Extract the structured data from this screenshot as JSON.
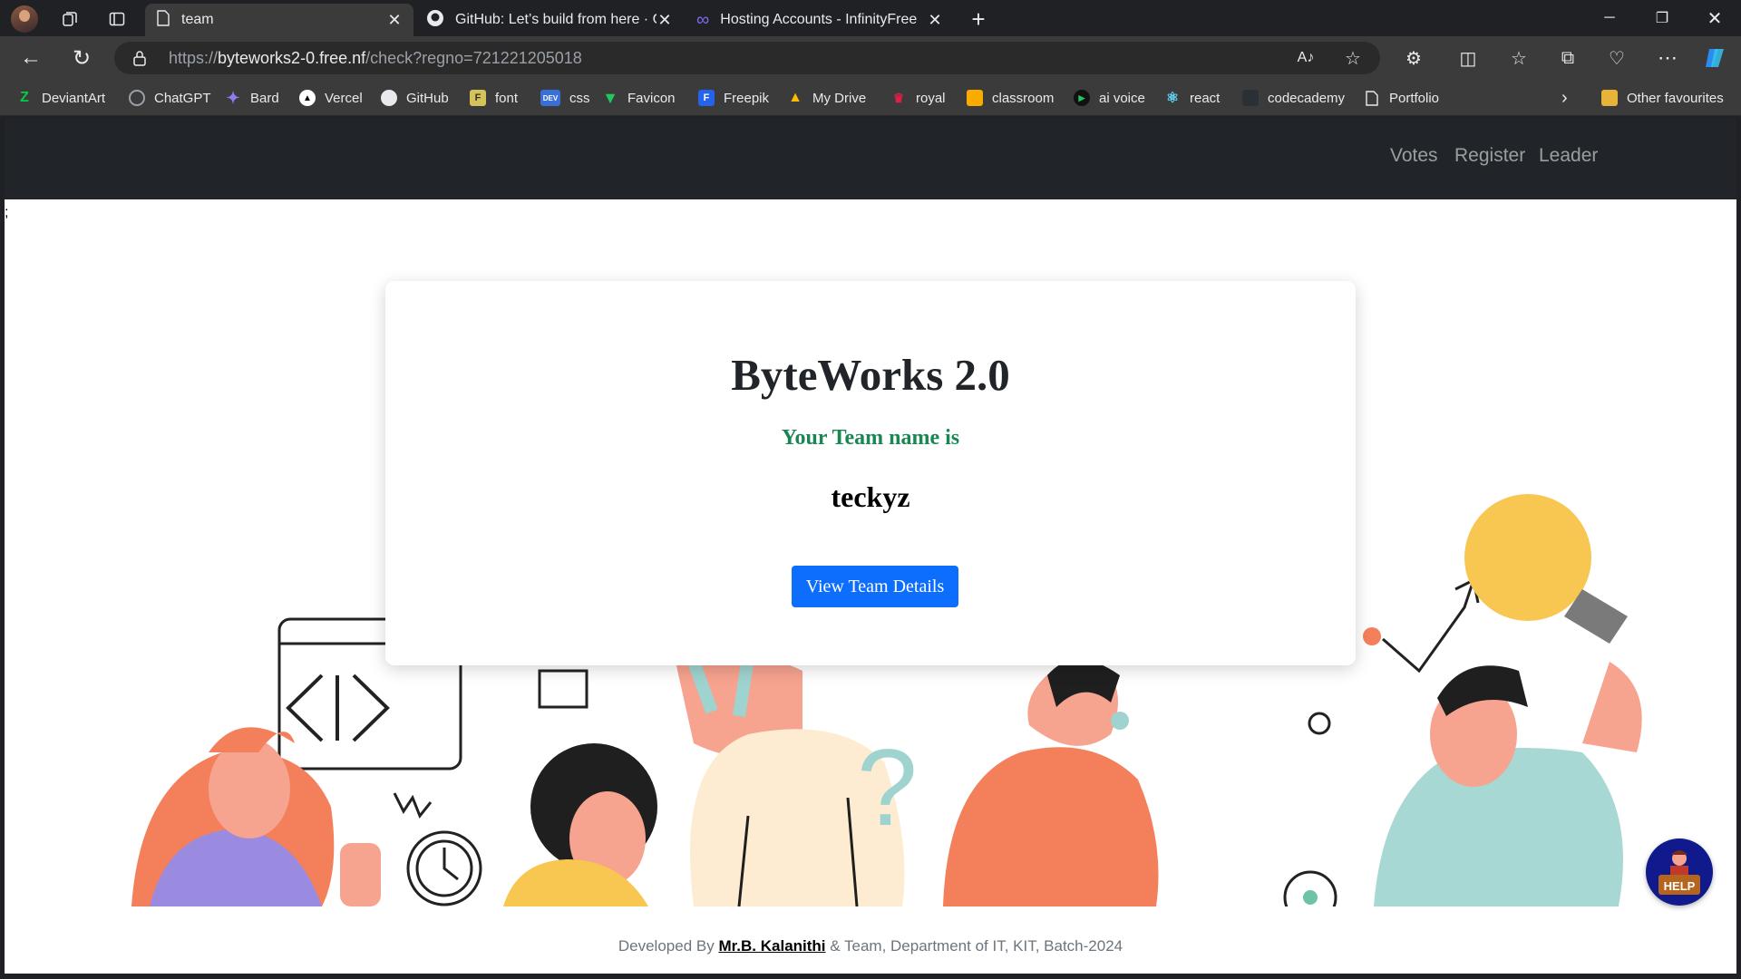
{
  "browser": {
    "tabs": [
      {
        "title": "team",
        "icon": "page-icon",
        "active": true
      },
      {
        "title": "GitHub: Let’s build from here · Gi",
        "icon": "github-icon",
        "active": false
      },
      {
        "title": "Hosting Accounts - InfinityFree",
        "icon": "infinity-icon",
        "active": false
      }
    ],
    "url_scheme": "https://",
    "url_host": "byteworks2-0.free.nf",
    "url_path": "/check?regno=721221205018",
    "bookmarks": [
      {
        "label": "DeviantArt",
        "icon": "deviantart-icon",
        "color": "#05cc47"
      },
      {
        "label": "ChatGPT",
        "icon": "chatgpt-icon",
        "color": "#74aa9c"
      },
      {
        "label": "Bard",
        "icon": "bard-icon",
        "color": "#8e7cf0"
      },
      {
        "label": "Vercel",
        "icon": "vercel-icon",
        "color": "#000000"
      },
      {
        "label": "GitHub",
        "icon": "github-icon",
        "color": "#ffffff"
      },
      {
        "label": "font",
        "icon": "font-icon",
        "color": "#d6c25a"
      },
      {
        "label": "css",
        "icon": "dev-icon",
        "color": "#3b6fd8"
      },
      {
        "label": "Favicon",
        "icon": "favicon-icon",
        "color": "#22c55e"
      },
      {
        "label": "Freepik",
        "icon": "freepik-icon",
        "color": "#2563eb"
      },
      {
        "label": "My Drive",
        "icon": "drive-icon",
        "color": "#fbbc04"
      },
      {
        "label": "royal",
        "icon": "royal-icon",
        "color": "#e11d48"
      },
      {
        "label": "classroom",
        "icon": "classroom-icon",
        "color": "#f9ab00"
      },
      {
        "label": "ai voice",
        "icon": "ai-voice-icon",
        "color": "#22c55e"
      },
      {
        "label": "react",
        "icon": "react-icon",
        "color": "#61dafb"
      },
      {
        "label": "codecademy",
        "icon": "codecademy-icon",
        "color": "#1f2937"
      },
      {
        "label": "Portfolio",
        "icon": "page-icon",
        "color": "#e8eaed"
      }
    ],
    "other_favourites": "Other favourites"
  },
  "page": {
    "nav_links": [
      "Votes",
      "Register",
      "Leader"
    ],
    "stray_text": ";",
    "card": {
      "title": "ByteWorks 2.0",
      "subtitle": "Your Team name is",
      "team_name": "teckyz",
      "button": "View Team Details"
    },
    "footer": {
      "prefix": "Developed By ",
      "name": "Mr.B. Kalanithi",
      "suffix": " & Team, Department of IT, KIT, Batch-2024"
    },
    "help_label": "HELP"
  },
  "colors": {
    "navbar": "#212529",
    "button": "#0d6efd",
    "subtitle": "#198754",
    "help_bg": "#101a8c"
  }
}
